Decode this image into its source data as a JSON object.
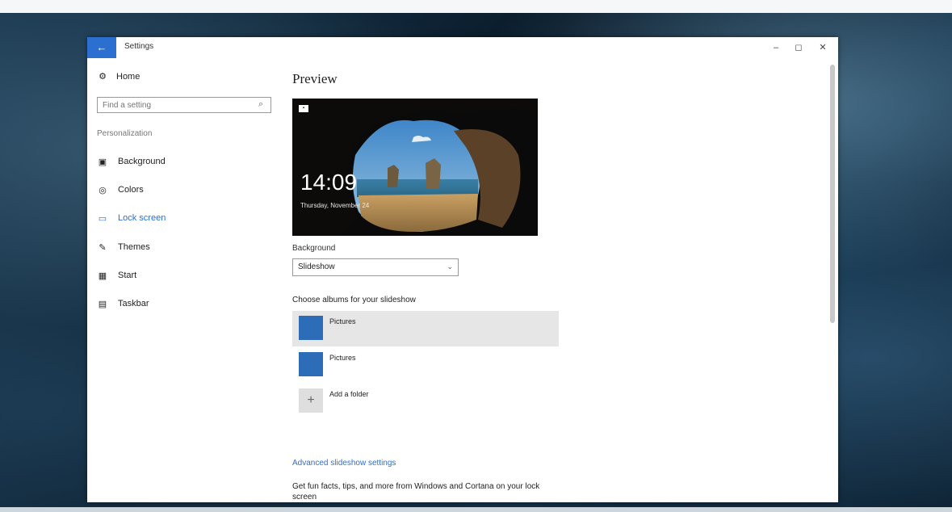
{
  "window": {
    "title": "Settings",
    "back_icon": "←",
    "minimize_icon": "–",
    "maximize_icon": "◻",
    "close_icon": "✕",
    "accent_color": "#2b6fd1"
  },
  "sidebar": {
    "home_label": "Home",
    "home_icon": "⚙",
    "search_placeholder": "Find a setting",
    "search_icon": "⌕",
    "section_title": "Personalization",
    "items": [
      {
        "label": "Background",
        "icon": "▣"
      },
      {
        "label": "Colors",
        "icon": "◎"
      },
      {
        "label": "Lock screen",
        "icon": "▭"
      },
      {
        "label": "Themes",
        "icon": "✎"
      },
      {
        "label": "Start",
        "icon": "▦"
      },
      {
        "label": "Taskbar",
        "icon": "▤"
      }
    ],
    "active_index": 2
  },
  "main": {
    "preview_title": "Preview",
    "preview_time": "14:09",
    "preview_date": "Thursday, November 24",
    "background_label": "Background",
    "background_value": "Slideshow",
    "chevron_icon": "⌄",
    "albums_label": "Choose albums for your slideshow",
    "albums": [
      {
        "label": "Pictures"
      },
      {
        "label": "Pictures"
      }
    ],
    "add_folder_label": "Add a folder",
    "add_icon": "+",
    "advanced_link": "Advanced slideshow settings",
    "tips_text": "Get fun facts, tips, and more from Windows and Cortana on your lock screen",
    "toggle_state": "On"
  }
}
